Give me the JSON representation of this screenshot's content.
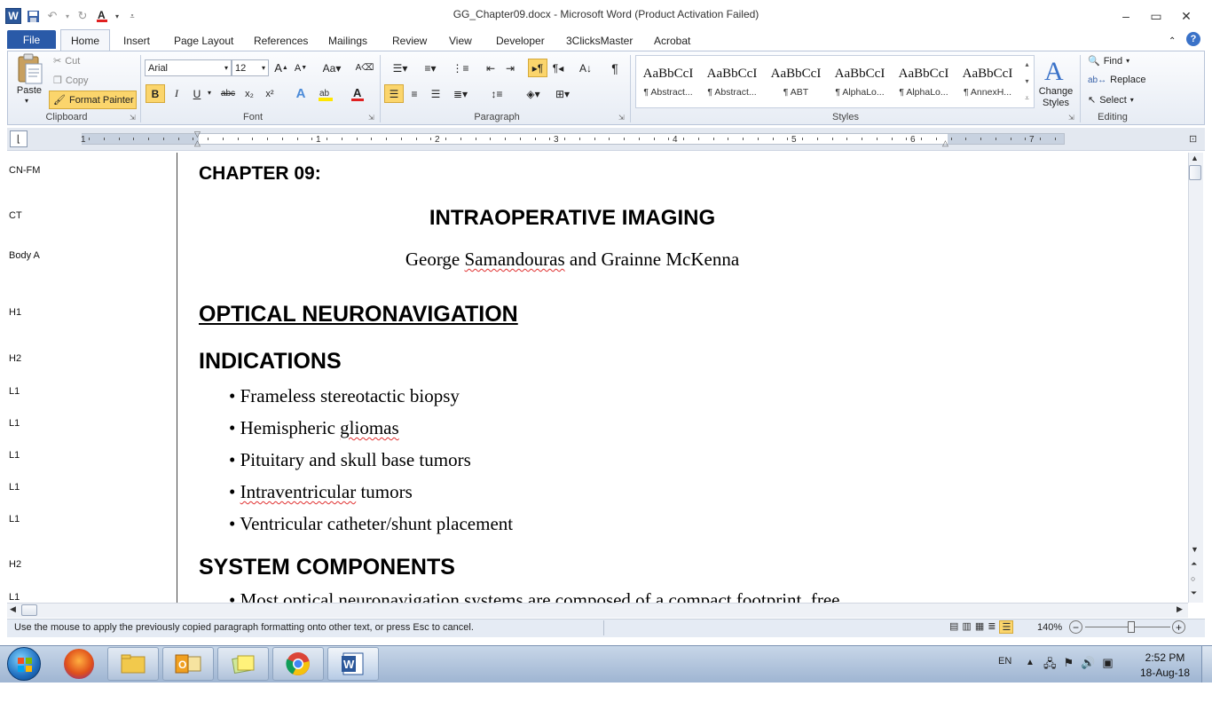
{
  "window": {
    "title": "GG_Chapter09.docx  -  Microsoft Word (Product Activation Failed)",
    "app_icon": "W"
  },
  "tabs": {
    "file": "File",
    "home": "Home",
    "items": [
      "Insert",
      "Page Layout",
      "References",
      "Mailings",
      "Review",
      "View",
      "Developer",
      "3ClicksMaster",
      "Acrobat"
    ]
  },
  "ribbon": {
    "clipboard": {
      "paste": "Paste",
      "cut": "Cut",
      "copy": "Copy",
      "format_painter": "Format Painter",
      "label": "Clipboard"
    },
    "font": {
      "name": "Arial",
      "size": "12",
      "label": "Font",
      "bold": "B",
      "italic": "I",
      "underline": "U",
      "strike": "abc",
      "sub": "x₂",
      "sup": "x²"
    },
    "paragraph": {
      "label": "Paragraph"
    },
    "styles": {
      "label": "Styles",
      "preview": "AaBbCcI",
      "items": [
        "¶ Abstract...",
        "¶ Abstract...",
        "¶ ABT",
        "¶ AlphaLo...",
        "¶ AlphaLo...",
        "¶ AnnexH..."
      ],
      "change_styles": "Change",
      "change_styles2": "Styles"
    },
    "editing": {
      "label": "Editing",
      "find": "Find",
      "replace": "Replace",
      "select": "Select"
    }
  },
  "ruler": {
    "numbers": [
      "1",
      "1",
      "2",
      "3",
      "4",
      "5",
      "6",
      "7"
    ]
  },
  "style_area": [
    "CN-FM",
    "CT",
    "Body A",
    "H1",
    "H2",
    "L1",
    "L1",
    "L1",
    "L1",
    "L1",
    "H2",
    "L1"
  ],
  "document": {
    "chapter": "CHAPTER 09:",
    "title": "INTRAOPERATIVE IMAGING",
    "authors": {
      "a": "George ",
      "b": "Samandouras",
      "c": " and Grainne McKenna"
    },
    "h1": "OPTICAL NEURONAVIGATION",
    "h2_indications": "INDICATIONS",
    "bullets": {
      "b1": "Frameless stereotactic biopsy",
      "b2a": "Hemispheric ",
      "b2b": "gliomas",
      "b3": "Pituitary and skull base tumors",
      "b4a": "Intraventricular",
      "b4b": " tumors",
      "b5": "Ventricular catheter/shunt placement"
    },
    "h2_components": "SYSTEM COMPONENTS",
    "partial": "Most optical neuronavigation systems are composed of a compact footprint, free"
  },
  "statusbar": {
    "message": "Use the mouse to apply the previously copied paragraph formatting onto other text, or press Esc to cancel.",
    "zoom": "140%"
  },
  "taskbar": {
    "lang": "EN",
    "time": "2:52 PM",
    "date": "18-Aug-18"
  },
  "colors": {
    "accent": "#2a5aa8",
    "ribbon_bg": "#e7ecf4",
    "highlight": "#fbd56c",
    "font_red": "#e02020"
  }
}
